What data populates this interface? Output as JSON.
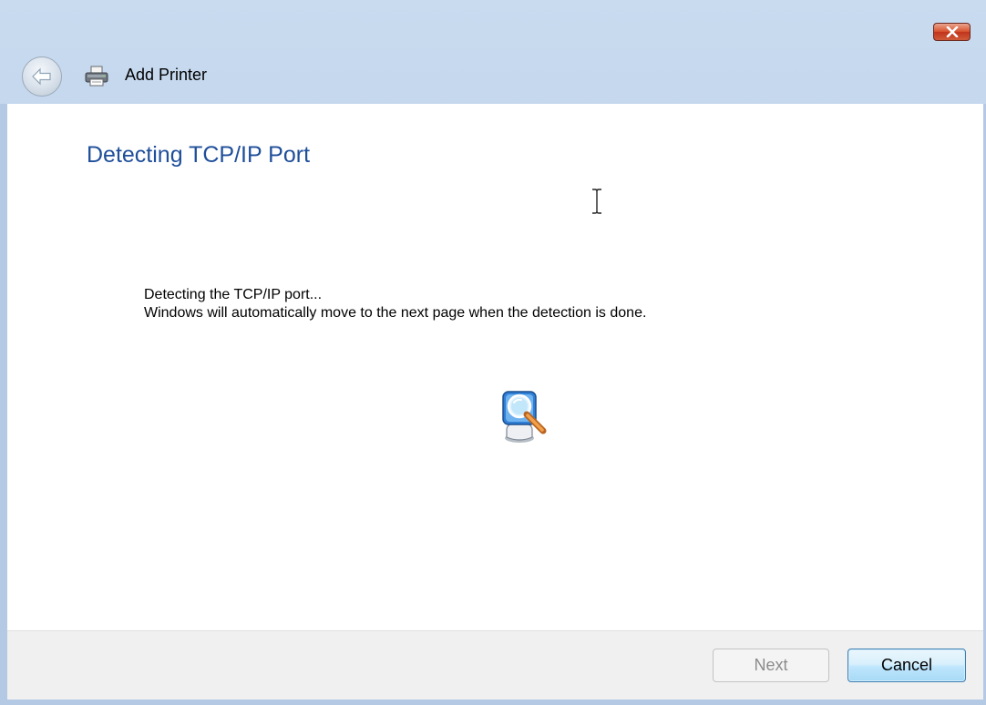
{
  "window": {
    "title": "Add Printer",
    "icons": {
      "close": "close-icon",
      "back": "back-arrow-icon",
      "app": "printer-icon"
    }
  },
  "page": {
    "heading": "Detecting TCP/IP Port",
    "message_line1": "Detecting the TCP/IP port...",
    "message_line2": "Windows will automatically move to the next page when the detection is done.",
    "status_icon": "search-magnifier-icon"
  },
  "footer": {
    "next_label": "Next",
    "cancel_label": "Cancel",
    "next_enabled": false
  },
  "colors": {
    "heading": "#1f4f9a",
    "title_bar": "#c9dbef",
    "close_button": "#d9532f",
    "cancel_border": "#3c7fb1",
    "disabled_text": "#8c8c8c"
  }
}
